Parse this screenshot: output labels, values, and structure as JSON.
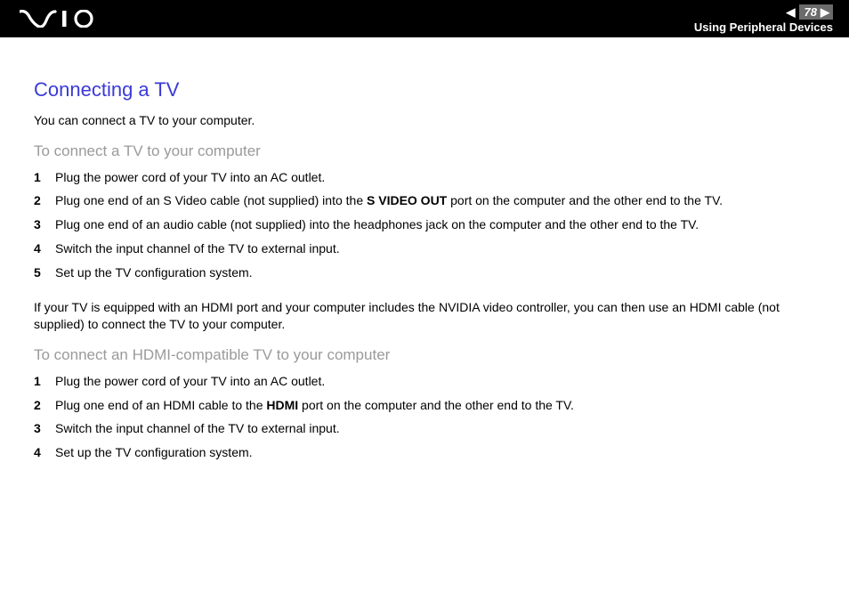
{
  "header": {
    "page_number": "78",
    "section": "Using Peripheral Devices"
  },
  "content": {
    "title": "Connecting a TV",
    "intro": "You can connect a TV to your computer.",
    "sub1": "To connect a TV to your computer",
    "steps1": [
      {
        "n": "1",
        "pre": "Plug the power cord of your TV into an AC outlet.",
        "bold": "",
        "post": ""
      },
      {
        "n": "2",
        "pre": "Plug one end of an S Video cable (not supplied) into the ",
        "bold": "S VIDEO OUT",
        "post": " port on the computer and the other end to the TV."
      },
      {
        "n": "3",
        "pre": "Plug one end of an audio cable (not supplied) into the headphones jack on the computer and the other end to the TV.",
        "bold": "",
        "post": ""
      },
      {
        "n": "4",
        "pre": "Switch the input channel of the TV to external input.",
        "bold": "",
        "post": ""
      },
      {
        "n": "5",
        "pre": "Set up the TV configuration system.",
        "bold": "",
        "post": ""
      }
    ],
    "note": "If your TV is equipped with an HDMI port and your computer includes the NVIDIA video controller, you can then use an HDMI cable (not supplied) to connect the TV to your computer.",
    "sub2": "To connect an HDMI-compatible TV to your computer",
    "steps2": [
      {
        "n": "1",
        "pre": "Plug the power cord of your TV into an AC outlet.",
        "bold": "",
        "post": ""
      },
      {
        "n": "2",
        "pre": "Plug one end of an HDMI cable to the ",
        "bold": "HDMI",
        "post": " port on the computer and the other end to the TV."
      },
      {
        "n": "3",
        "pre": "Switch the input channel of the TV to external input.",
        "bold": "",
        "post": ""
      },
      {
        "n": "4",
        "pre": "Set up the TV configuration system.",
        "bold": "",
        "post": ""
      }
    ]
  }
}
